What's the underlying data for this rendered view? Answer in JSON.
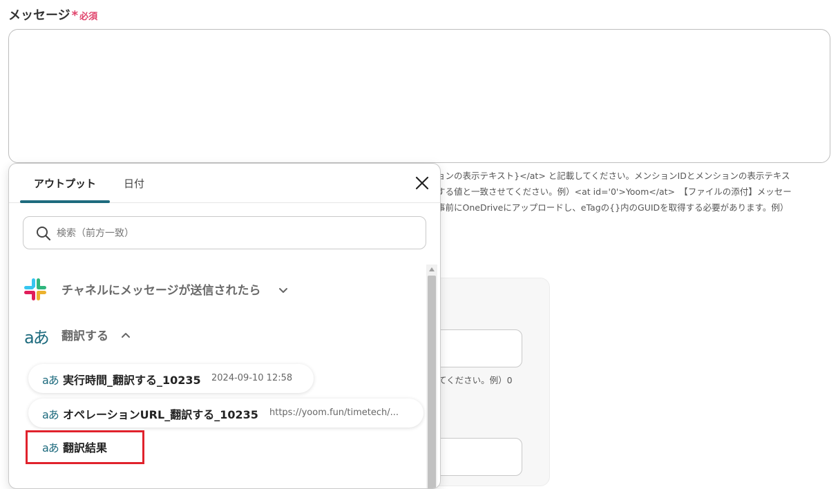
{
  "form": {
    "label": "メッセージ",
    "required_star": "*",
    "required_text": "必須",
    "help_lines": [
      "ョンの表示テキスト}</at> と記載してください。メンションIDとメンションの表示テキス",
      "する値と一致させてください。例）<at id='0'>Yoom</at>　【ファイルの添付】メッセー",
      "事前にOneDriveにアップロードし、eTagの{}内のGUIDを取得する必要があります。例）"
    ],
    "bg_hint": "てください。例）0"
  },
  "popup": {
    "tabs": [
      "アウトプット",
      "日付"
    ],
    "search_placeholder": "検索（前方一致）",
    "sections": [
      {
        "label": "チャネルにメッセージが送信されたら",
        "icon": "slack-icon",
        "expanded": false
      },
      {
        "label": "翻訳する",
        "icon": "translate-icon",
        "expanded": true
      }
    ],
    "translate_icon_text": "aあ",
    "items": [
      {
        "label": "実行時間_翻訳する_10235",
        "value": "2024-09-10 12:58"
      },
      {
        "label": "オペレーションURL_翻訳する_10235",
        "value": "https://yoom.fun/timetech/..."
      },
      {
        "label": "翻訳結果",
        "value": ""
      }
    ]
  },
  "colors": {
    "accent": "#1e6b7e",
    "required": "#e0436b",
    "highlight": "#e0222c"
  }
}
